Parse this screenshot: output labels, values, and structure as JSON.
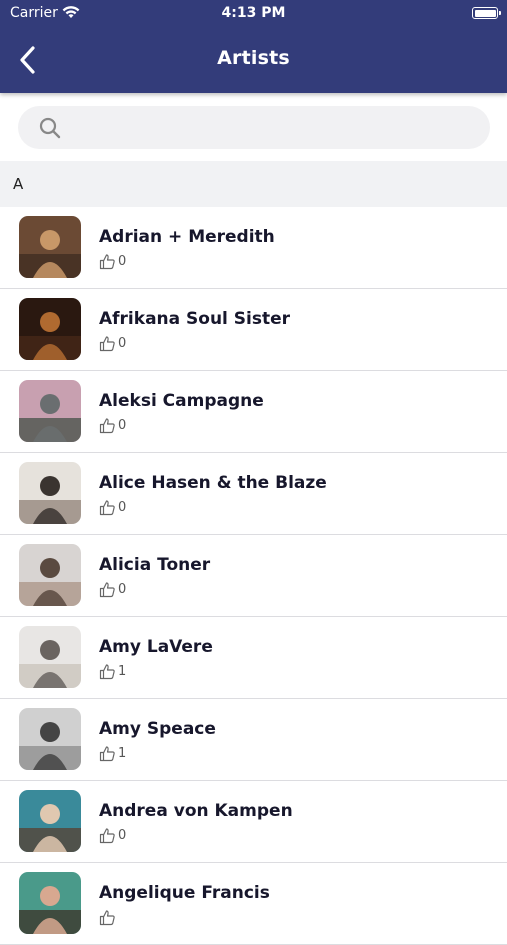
{
  "status_bar": {
    "carrier": "Carrier",
    "time": "4:13 PM"
  },
  "header": {
    "title": "Artists"
  },
  "search": {
    "placeholder": ""
  },
  "section": {
    "letter": "A"
  },
  "colors": {
    "header_bg": "#333c7a",
    "section_bg": "#f1f2f4",
    "search_bg": "#f1f1f3"
  },
  "artists": [
    {
      "name": "Adrian + Meredith",
      "likes": "0",
      "photo": [
        "#6b4a34",
        "#c89868",
        "#3a2a20"
      ]
    },
    {
      "name": "Afrikana Soul Sister",
      "likes": "0",
      "photo": [
        "#2a1810",
        "#b06a30",
        "#4a2a1a"
      ]
    },
    {
      "name": "Aleksi Campagne",
      "likes": "0",
      "photo": [
        "#c8a0b0",
        "#6a6e70",
        "#3a4a40"
      ]
    },
    {
      "name": "Alice Hasen & the Blaze",
      "likes": "0",
      "photo": [
        "#e6e2dc",
        "#3a3430",
        "#8a7c70"
      ]
    },
    {
      "name": "Alicia Toner",
      "likes": "0",
      "photo": [
        "#d8d4d2",
        "#5a4a40",
        "#a89080"
      ]
    },
    {
      "name": "Amy LaVere",
      "likes": "1",
      "photo": [
        "#e8e6e4",
        "#6a6460",
        "#c8c0b8"
      ]
    },
    {
      "name": "Amy Speace",
      "likes": "1",
      "photo": [
        "#d0d0d0",
        "#444444",
        "#888888"
      ]
    },
    {
      "name": "Andrea von Kampen",
      "likes": "0",
      "photo": [
        "#3a8a9a",
        "#e0c8b0",
        "#5a3a2a"
      ]
    },
    {
      "name": "Angelique Francis",
      "likes": "",
      "photo": [
        "#4a9a8a",
        "#d8a890",
        "#3a2a20"
      ]
    }
  ]
}
